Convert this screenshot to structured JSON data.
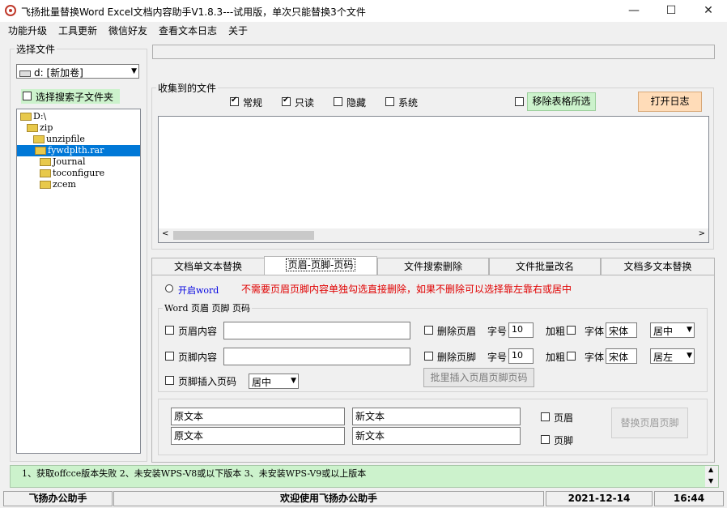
{
  "window": {
    "title": "飞扬批量替换Word Excel文档内容助手V1.8.3---试用版，单次只能替换3个文件",
    "minimize": "—",
    "maximize": "☐",
    "close": "✕"
  },
  "menu": [
    "功能升级",
    "工具更新",
    "微信好友",
    "查看文本日志",
    "关于"
  ],
  "left_panel": {
    "title": "选择文件",
    "drive": "d: [新加卷]",
    "include_sub": "选择搜索子文件夹",
    "tree": [
      {
        "label": "D:\\",
        "level": 0,
        "selected": false
      },
      {
        "label": "zip",
        "level": 1,
        "selected": false
      },
      {
        "label": "unzipfile",
        "level": 2,
        "selected": false
      },
      {
        "label": "fywdplth.rar",
        "level": 3,
        "selected": true
      },
      {
        "label": "Journal",
        "level": 4,
        "selected": false
      },
      {
        "label": "toconfigure",
        "level": 4,
        "selected": false
      },
      {
        "label": "zcem",
        "level": 4,
        "selected": false
      }
    ]
  },
  "path_bar": "",
  "collected": {
    "title": "收集到的文件",
    "filters": [
      {
        "label": "常规",
        "checked": true
      },
      {
        "label": "只读",
        "checked": true
      },
      {
        "label": "隐藏",
        "checked": false
      },
      {
        "label": "系统",
        "checked": false
      }
    ],
    "remove_btn": "移除表格所选",
    "open_log_btn": "打开日志"
  },
  "tabs": [
    {
      "label": "文档单文本替换",
      "active": false
    },
    {
      "label": "页眉-页脚-页码",
      "active": true
    },
    {
      "label": "文件搜索删除",
      "active": false
    },
    {
      "label": "文件批量改名",
      "active": false
    },
    {
      "label": "文档多文本替换",
      "active": false
    }
  ],
  "header_footer": {
    "open_word": "开启word",
    "notice": "不需要页眉页脚内容单独勾选直接删除，如果不删除可以选择靠左靠右或居中",
    "group_title": "Word 页眉 页脚 页码",
    "header_content": "页眉内容",
    "footer_content": "页脚内容",
    "delete_header": "删除页眉",
    "delete_footer": "删除页脚",
    "font_size_label": "字号",
    "bold_label": "加粗",
    "font_label": "字体",
    "header_size": "10",
    "footer_size": "10",
    "header_font": "宋体",
    "footer_font": "宋体",
    "header_align": "居中",
    "footer_align": "居左",
    "footer_insert_page": "页脚插入页码",
    "page_align": "居中",
    "batch_insert_btn": "批里插入页眉页脚页码",
    "orig1": "原文本",
    "new1": "新文本",
    "orig2": "原文本",
    "new2": "新文本",
    "chk_header": "页眉",
    "chk_footer": "页脚",
    "replace_btn": "替换页眉页脚"
  },
  "log_line": "1、获取offcce版本失败  2、未安装WPS-V8或以下版本  3、未安装WPS-V9或以上版本",
  "statusbar": {
    "app": "飞扬办公助手",
    "welcome": "欢迎使用飞扬办公助手",
    "date": "2021-12-14",
    "time": "16:44"
  },
  "colors": {
    "green_button": "#ccf2cc",
    "orange_button": "#ffdcb8",
    "notice_red": "#e00000",
    "link_blue": "#0000e0",
    "log_green": "#ccf2cc",
    "selection": "#0078d7"
  }
}
